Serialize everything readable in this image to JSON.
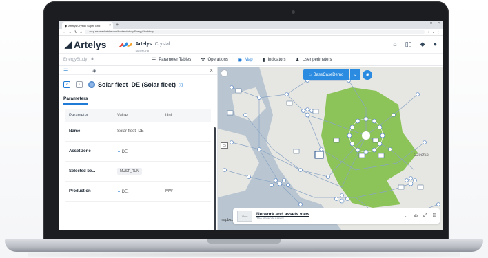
{
  "browser": {
    "tab_title": "Artelys Crystal Super Grid",
    "url": "assp.reservedartelys.com/frontend/study/EnergyStudy/map"
  },
  "header": {
    "brand": "Artelys",
    "product": "Artelys",
    "product_suffix": "Crystal",
    "product_sub": "Super Grid"
  },
  "nav": {
    "study": "EnergyStudy",
    "items": [
      {
        "label": "Parameter Tables",
        "icon": "table-icon"
      },
      {
        "label": "Operations",
        "icon": "wrench-icon"
      },
      {
        "label": "Map",
        "icon": "globe-icon",
        "active": true
      },
      {
        "label": "Indicators",
        "icon": "bar-chart-icon"
      },
      {
        "label": "User perimeters",
        "icon": "user-icon"
      }
    ]
  },
  "panel": {
    "asset_title": "Solar fleet_DE (Solar fleet)",
    "tab": "Parameters",
    "columns": [
      "Parameter",
      "Value",
      "Unit"
    ],
    "rows": [
      {
        "param": "Name",
        "value": "Solar fleet_DE",
        "unit": ""
      },
      {
        "param": "Asset zone",
        "value": "DE",
        "unit": ""
      },
      {
        "param": "Selected be...",
        "value": "MUST_RUN",
        "unit": ""
      },
      {
        "param": "Production",
        "value": "DE,",
        "unit": "MW"
      }
    ]
  },
  "map": {
    "case_button": "BaseCaseDemo",
    "bottom_title": "Network and assets view",
    "bottom_sub": "The Network Assets",
    "label_czech": "Czechia",
    "attribution": "mapbox",
    "thumb_label": "View"
  }
}
